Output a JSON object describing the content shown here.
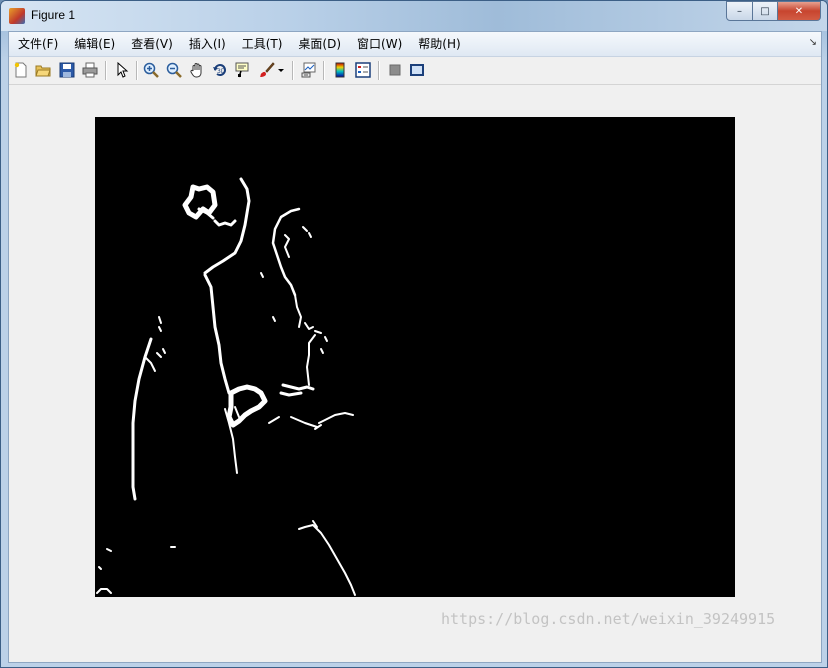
{
  "window": {
    "title": "Figure 1"
  },
  "caption": {
    "minimize": "–",
    "maximize": "□",
    "close": "✕"
  },
  "menu": {
    "items": [
      "文件(F)",
      "编辑(E)",
      "查看(V)",
      "插入(I)",
      "工具(T)",
      "桌面(D)",
      "窗口(W)",
      "帮助(H)"
    ],
    "overflow_icon": "dock-arrow-icon"
  },
  "toolbar": {
    "icons": [
      "new-figure-icon",
      "open-file-icon",
      "save-icon",
      "print-icon",
      "edit-plot-icon",
      "zoom-in-icon",
      "zoom-out-icon",
      "pan-icon",
      "rotate-3d-icon",
      "data-cursor-icon",
      "brush-icon",
      "brush-dropdown-icon",
      "link-plot-icon",
      "insert-colorbar-icon",
      "insert-legend-icon",
      "hide-plot-tools-icon",
      "show-plot-tools-icon"
    ]
  },
  "figure": {
    "background": "#000000",
    "foreground": "#ffffff"
  },
  "watermark": "https://blog.csdn.net/weixin_39249915"
}
